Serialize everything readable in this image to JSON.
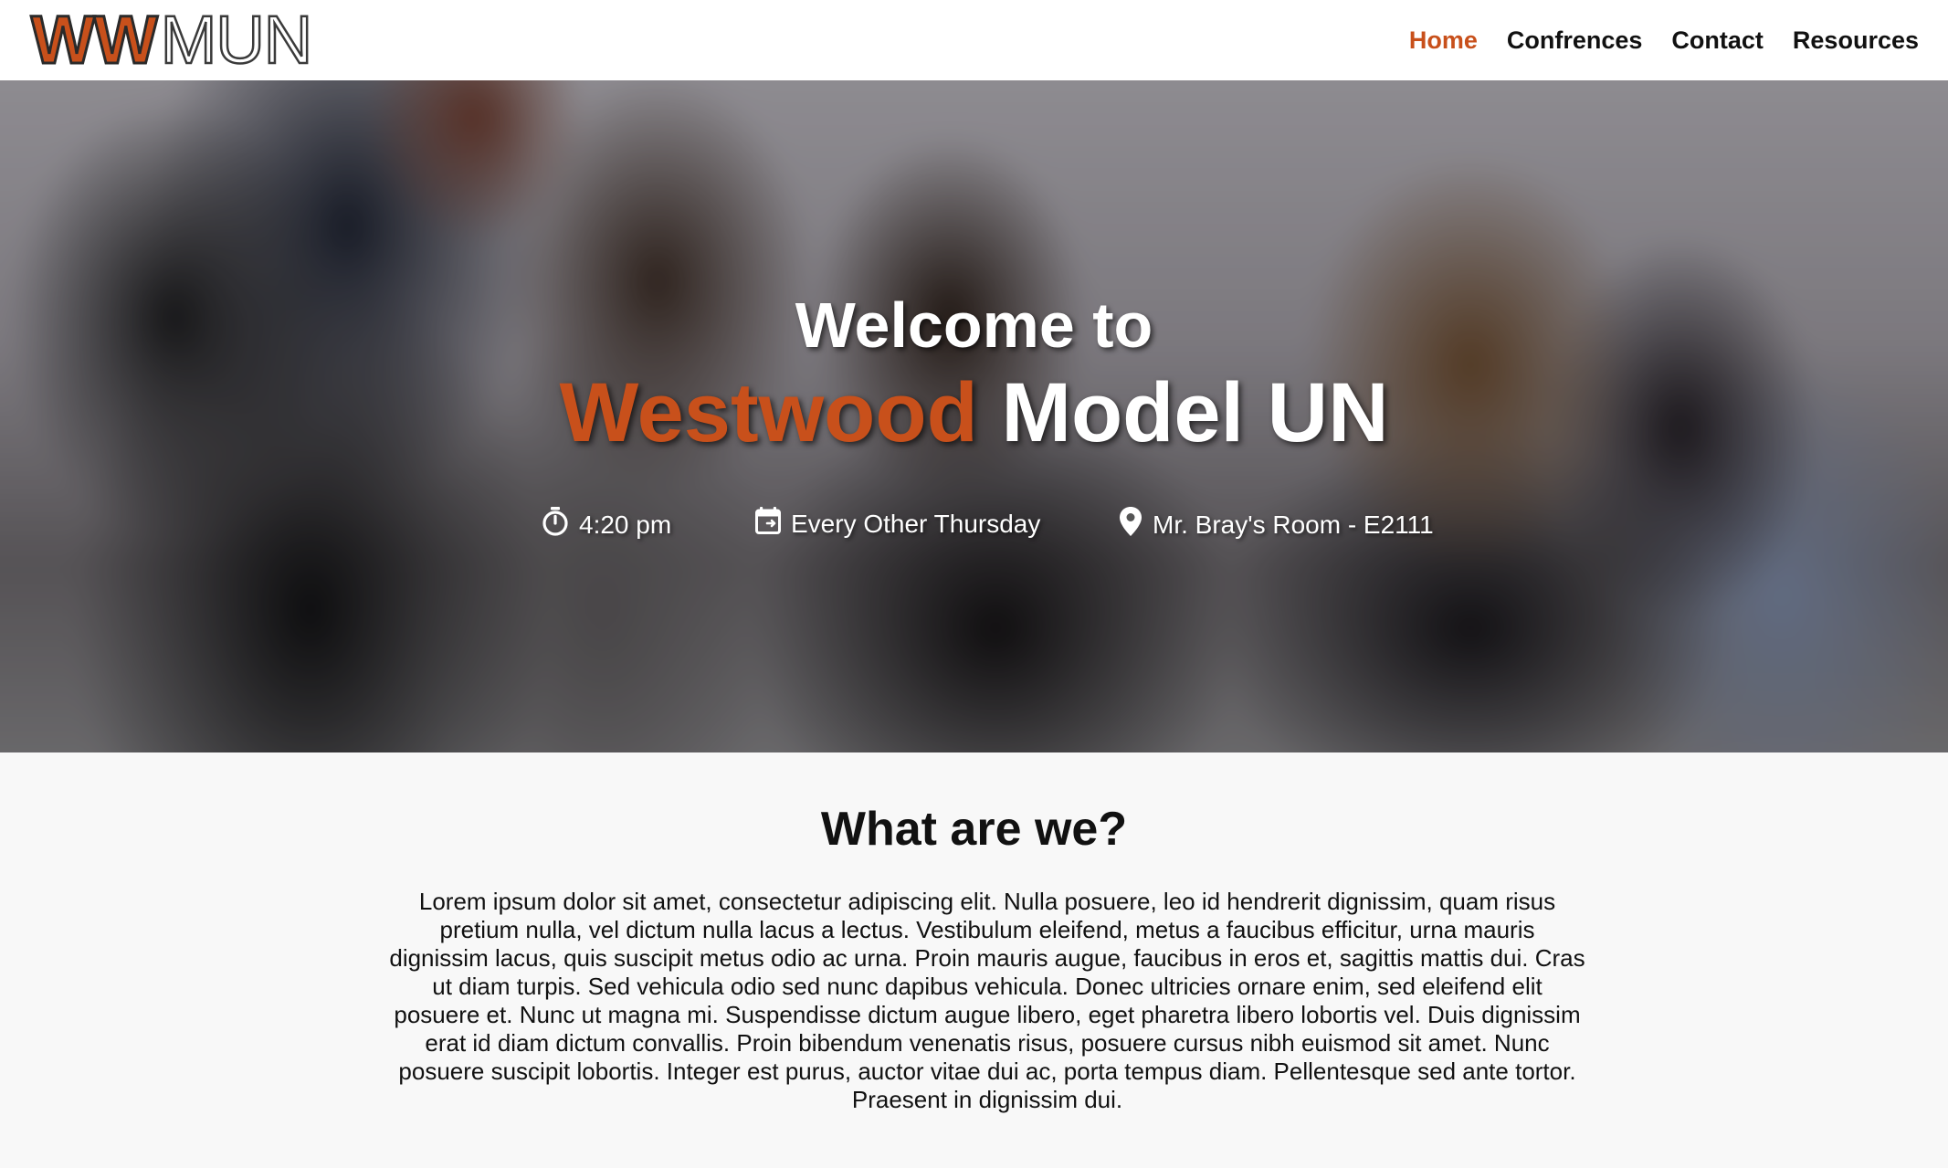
{
  "header": {
    "logo": {
      "part1": "WW",
      "part2": "MUN"
    },
    "nav": [
      {
        "label": "Home",
        "active": true
      },
      {
        "label": "Confrences",
        "active": false
      },
      {
        "label": "Contact",
        "active": false
      },
      {
        "label": "Resources",
        "active": false
      }
    ]
  },
  "hero": {
    "welcome": "Welcome to",
    "title_accent": "Westwood",
    "title_rest": " Model UN",
    "info": {
      "time": {
        "icon": "timer-icon",
        "text": "4:20 pm"
      },
      "day": {
        "icon": "calendar-icon",
        "text": "Every Other Thursday"
      },
      "room": {
        "icon": "location-pin-icon",
        "text": "Mr. Bray's Room - E2111"
      }
    }
  },
  "about": {
    "title": "What are we?",
    "body": "Lorem ipsum dolor sit amet, consectetur adipiscing elit. Nulla posuere, leo id hendrerit dignissim, quam risus pretium nulla, vel dictum nulla lacus a lectus. Vestibulum eleifend, metus a faucibus efficitur, urna mauris dignissim lacus, quis suscipit metus odio ac urna. Proin mauris augue, faucibus in eros et, sagittis mattis dui. Cras ut diam turpis. Sed vehicula odio sed nunc dapibus vehicula. Donec ultricies ornare enim, sed eleifend elit posuere et. Nunc ut magna mi. Suspendisse dictum augue libero, eget pharetra libero lobortis vel. Duis dignissim erat id diam dictum convallis. Proin bibendum venenatis risus, posuere cursus nibh euismod sit amet. Nunc posuere suscipit lobortis. Integer est purus, auctor vitae dui ac, porta tempus diam. Pellentesque sed ante tortor. Praesent in dignissim dui."
  },
  "colors": {
    "accent": "#c8501b",
    "header_bg": "#ffffff",
    "page_bg": "#f8f8f8",
    "text": "#111111"
  }
}
